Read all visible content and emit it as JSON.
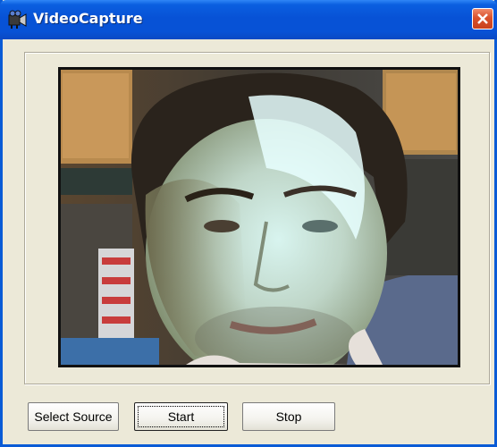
{
  "window": {
    "title": "VideoCapture",
    "app_icon": "video-capture-app-icon",
    "close_icon": "close-icon"
  },
  "video": {
    "content": "webcam-preview-image"
  },
  "buttons": {
    "select_source": "Select Source",
    "start": "Start",
    "stop": "Stop"
  },
  "colors": {
    "titlebar": "#0752d6",
    "close_button": "#d9512c",
    "dialog_background": "#ece9d8"
  }
}
